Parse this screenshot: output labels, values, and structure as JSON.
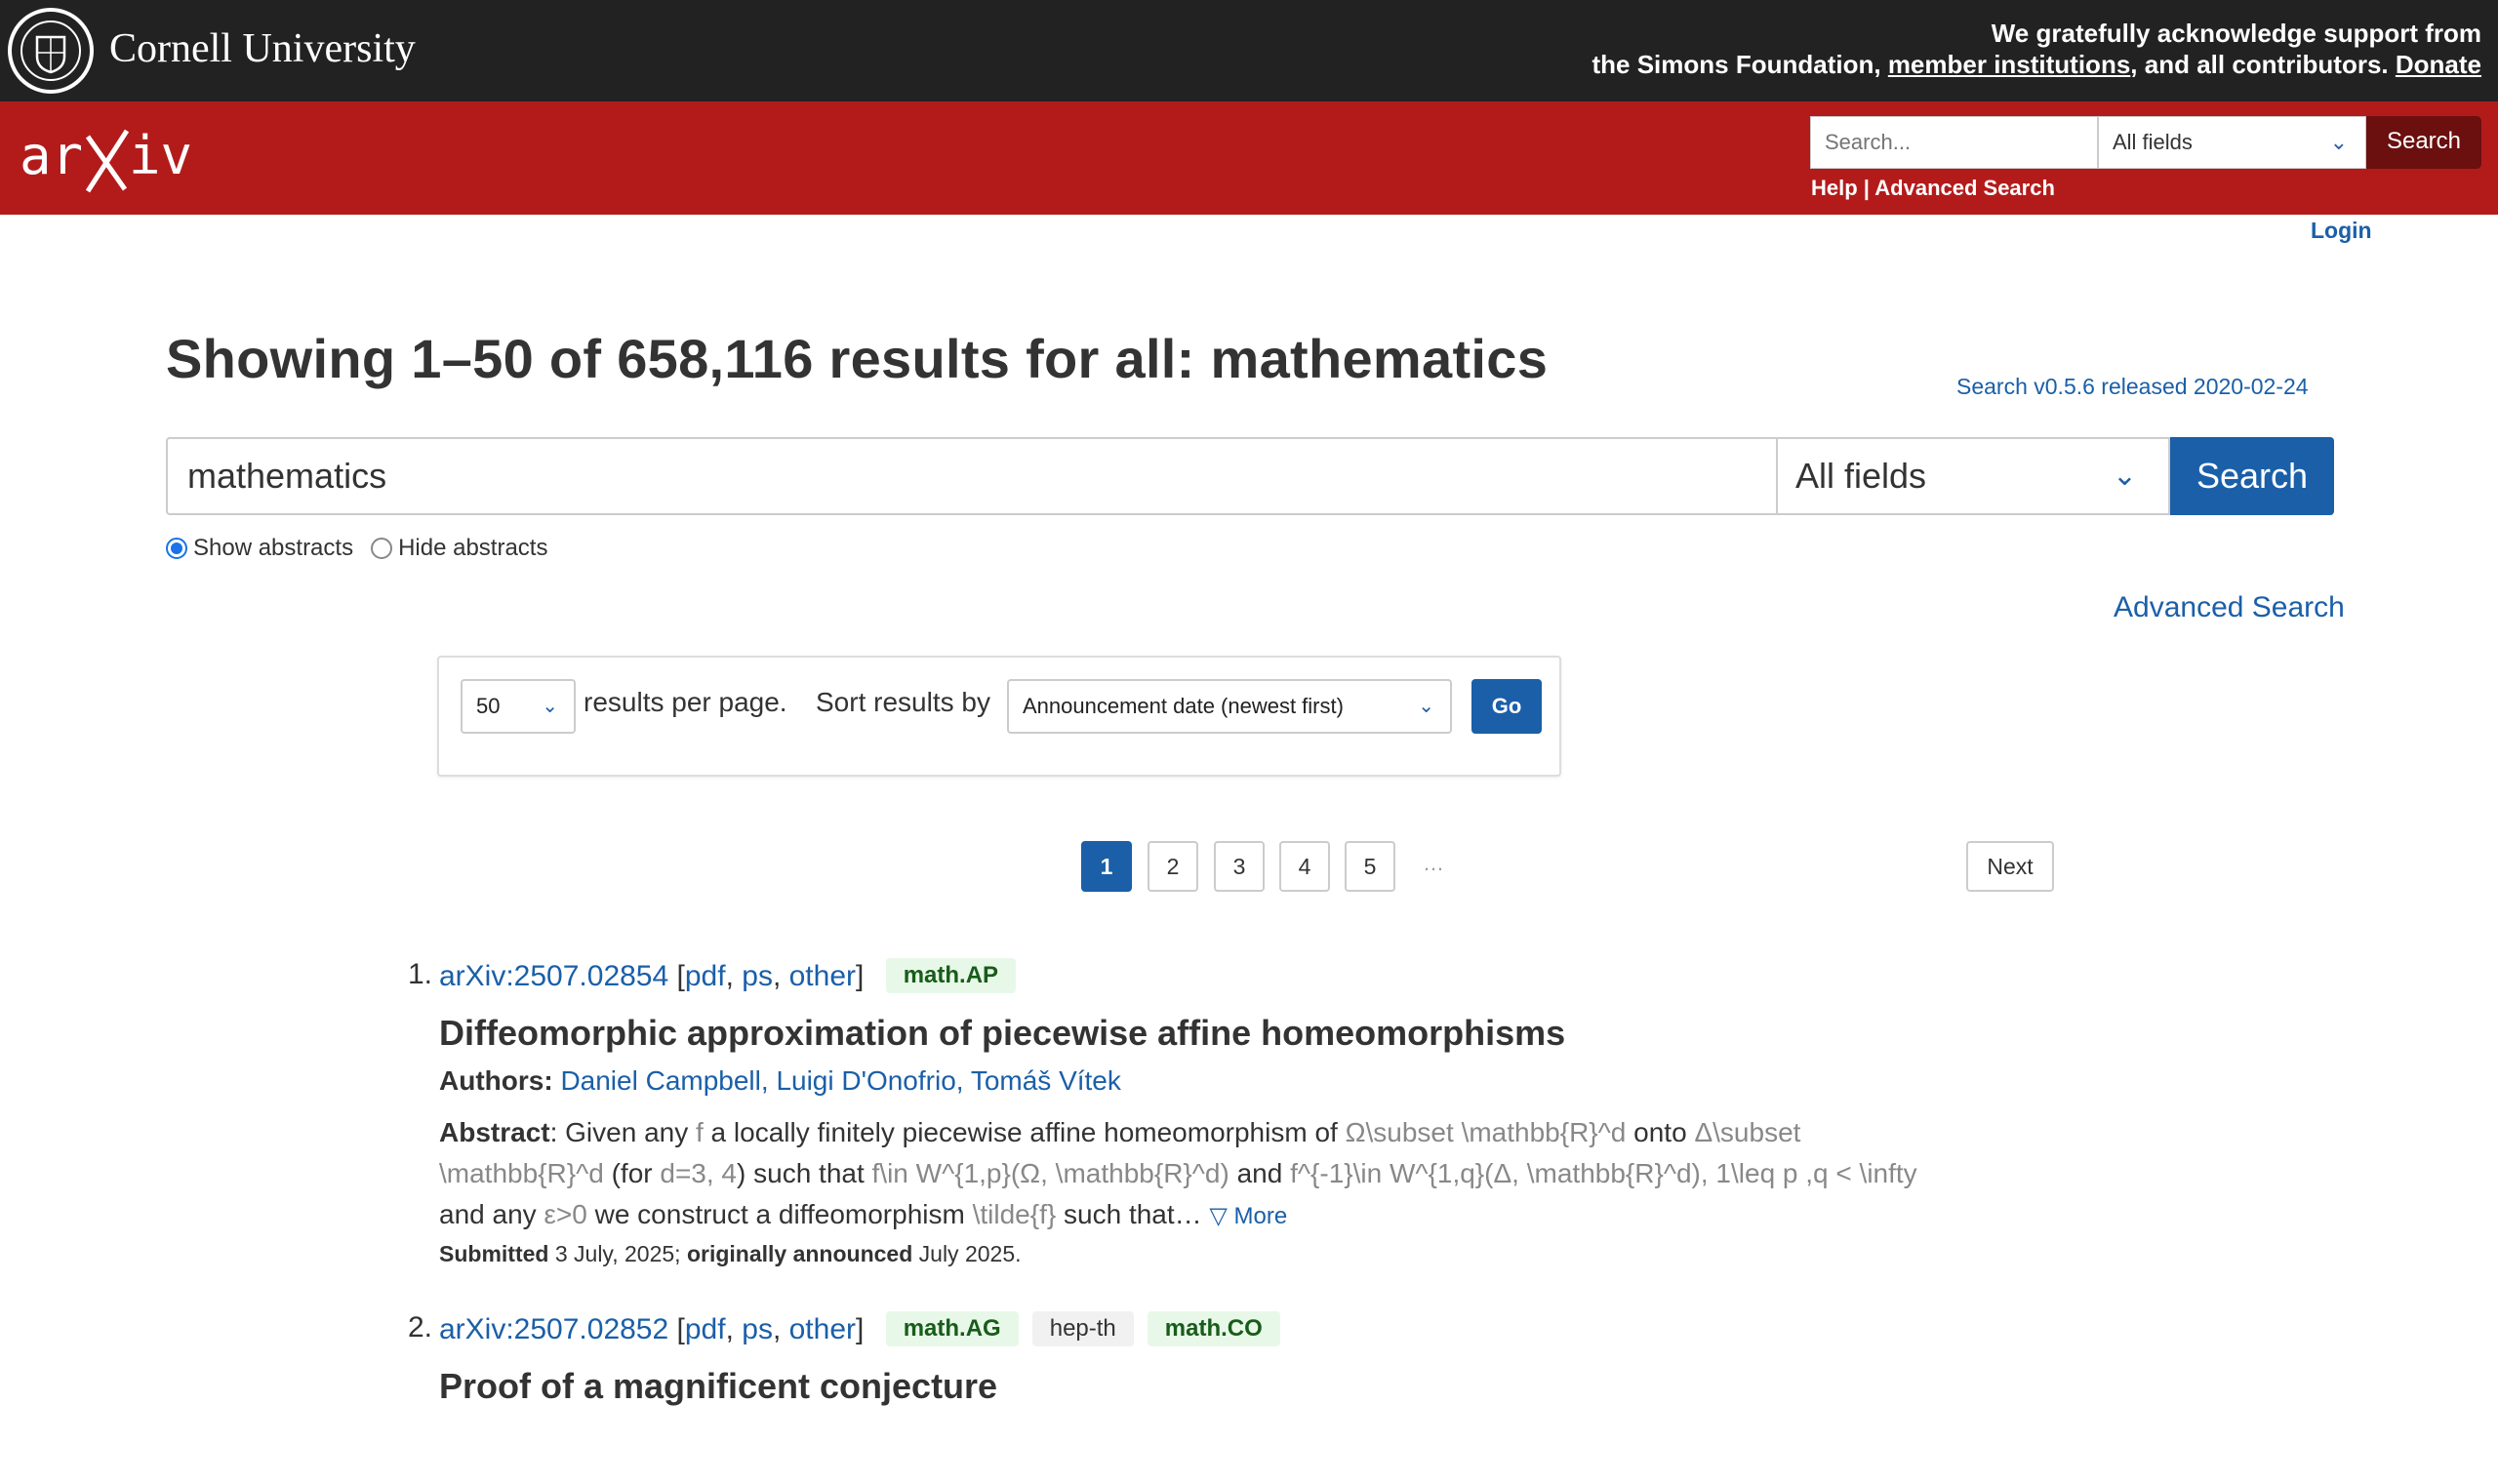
{
  "cornell": {
    "name": "Cornell University"
  },
  "support": {
    "line1": "We gratefully acknowledge support from",
    "line2_pre": "the Simons Foundation, ",
    "member_link": "member institutions",
    "line2_mid": ", and all contributors. ",
    "donate_link": "Donate"
  },
  "header": {
    "logo_text": "arXiv",
    "search_placeholder": "Search...",
    "field_value": "All fields",
    "search_button": "Search",
    "help_link": "Help",
    "separator": " | ",
    "advanced_link": "Advanced Search"
  },
  "login": "Login",
  "main": {
    "title": "Showing 1–50 of 658,116 results for all: mathematics",
    "version": "Search v0.5.6 released 2020-02-24",
    "search_value": "mathematics",
    "field_value": "All fields",
    "search_button": "Search",
    "show_abstracts": "Show abstracts",
    "hide_abstracts": "Hide abstracts",
    "advanced_search": "Advanced Search"
  },
  "options": {
    "per_page_value": "50",
    "per_page_label": "results per page.",
    "sort_label": "Sort results by",
    "sort_value": "Announcement date (newest first)",
    "go_button": "Go"
  },
  "pagination": {
    "pages": [
      "1",
      "2",
      "3",
      "4",
      "5"
    ],
    "current": "1",
    "ellipsis": "…",
    "next": "Next"
  },
  "results": [
    {
      "num": "1.",
      "id": "arXiv:2507.02854",
      "formats": [
        "pdf",
        "ps",
        "other"
      ],
      "tags": [
        "math.AP"
      ],
      "title": "Diffeomorphic approximation of piecewise affine homeomorphisms",
      "authors_label": "Authors:",
      "authors": [
        "Daniel Campbell",
        "Luigi D'Onofrio",
        "Tomáš Vítek"
      ],
      "abstract_label": "Abstract",
      "abstract_line1_a": ": Given any ",
      "abstract_line1_m1": "f",
      "abstract_line1_b": " a locally finitely piecewise affine homeomorphism of ",
      "abstract_line1_m2": "Ω\\subset \\mathbb{R}^d",
      "abstract_line1_c": " onto ",
      "abstract_line1_m3": "Δ\\subset",
      "abstract_line2_m1": "\\mathbb{R}^d",
      "abstract_line2_a": " (for ",
      "abstract_line2_m2": "d=3, 4",
      "abstract_line2_b": ") such that ",
      "abstract_line2_m3": "f\\in W^{1,p}(Ω, \\mathbb{R}^d)",
      "abstract_line2_c": " and ",
      "abstract_line2_m4": "f^{-1}\\in W^{1,q}(Δ, \\mathbb{R}^d), 1\\leq p ,q < \\infty",
      "abstract_line3_a": "and any ",
      "abstract_line3_m1": "ε>0",
      "abstract_line3_b": " we construct a diffeomorphism ",
      "abstract_line3_m2": "\\tilde{f}",
      "abstract_line3_c": " such that… ",
      "more": "▽ More",
      "submitted_label": "Submitted",
      "submitted_date": " 3 July, 2025; ",
      "announced_label": "originally announced",
      "announced_date": " July 2025."
    },
    {
      "num": "2.",
      "id": "arXiv:2507.02852",
      "formats": [
        "pdf",
        "ps",
        "other"
      ],
      "tags": [
        "math.AG",
        "hep-th",
        "math.CO"
      ],
      "title": "Proof of a magnificent conjecture"
    }
  ],
  "colors": {
    "cornell_bar": "#222222",
    "arxiv_red": "#b31b1b",
    "link_blue": "#1a5fa8",
    "tag_green_bg": "#e8f8e8"
  }
}
